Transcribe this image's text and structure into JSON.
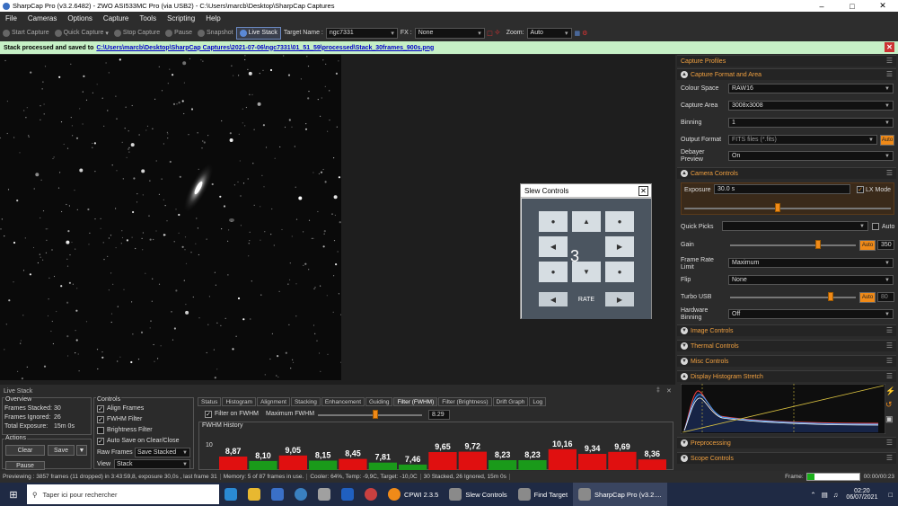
{
  "window": {
    "title": "SharpCap Pro (v3.2.6482) - ZWO ASI533MC Pro (via USB2) - C:\\Users\\marcb\\Desktop\\SharpCap Captures"
  },
  "menu": [
    "File",
    "Cameras",
    "Options",
    "Capture",
    "Tools",
    "Scripting",
    "Help"
  ],
  "toolbar": {
    "start_capture": "Start Capture",
    "quick_capture": "Quick Capture",
    "stop_capture": "Stop Capture",
    "pause": "Pause",
    "snapshot": "Snapshot",
    "live_stack": "Live Stack",
    "target_label": "Target Name :",
    "target_value": "ngc7331",
    "fx_label": "FX :",
    "fx_value": "None",
    "zoom_label": "Zoom:",
    "zoom_value": "Auto"
  },
  "notification": {
    "prefix": "Stack processed and saved to",
    "path": "C:\\Users\\marcb\\Desktop\\SharpCap Captures\\2021-07-06\\ngc7331\\01_51_59\\processed\\Stack_30frames_900s.png"
  },
  "right_panel": {
    "sections": {
      "capture_profiles": "Capture Profiles",
      "capture_format": "Capture Format and Area",
      "camera_controls": "Camera Controls",
      "image_controls": "Image Controls",
      "thermal_controls": "Thermal Controls",
      "misc_controls": "Misc Controls",
      "histogram": "Display Histogram Stretch",
      "preprocessing": "Preprocessing",
      "scope_controls": "Scope Controls"
    },
    "colour_space": {
      "label": "Colour Space",
      "value": "RAW16"
    },
    "capture_area": {
      "label": "Capture Area",
      "value": "3008x3008"
    },
    "binning": {
      "label": "Binning",
      "value": "1"
    },
    "output_format": {
      "label": "Output Format",
      "value": "FITS files (*.fits)",
      "auto": "Auto"
    },
    "debayer": {
      "label": "Debayer Preview",
      "value": "On"
    },
    "exposure": {
      "label": "Exposure",
      "value": "30.0 s",
      "lx_mode": "LX Mode",
      "level": 0.45
    },
    "quick_picks": {
      "label": "Quick Picks",
      "auto": "Auto"
    },
    "gain": {
      "label": "Gain",
      "auto": "Auto",
      "value": "350",
      "level": 0.7
    },
    "frame_rate": {
      "label": "Frame Rate Limit",
      "value": "Maximum"
    },
    "flip": {
      "label": "Flip",
      "value": "None"
    },
    "turbo_usb": {
      "label": "Turbo USB",
      "auto": "Auto",
      "value": "80",
      "level": 0.8
    },
    "hardware_binning": {
      "label": "Hardware Binning",
      "value": "Off"
    }
  },
  "slew": {
    "title": "Slew Controls",
    "rate_number": "3",
    "rate_label": "RATE"
  },
  "live_stack": {
    "title": "Live Stack",
    "overview_title": "Overview",
    "frames_stacked_label": "Frames Stacked:",
    "frames_stacked": "30",
    "frames_ignored_label": "Frames Ignored:",
    "frames_ignored": "26",
    "total_exposure_label": "Total Exposure:",
    "total_exposure": "15m 0s",
    "actions_title": "Actions",
    "clear": "Clear",
    "save": "Save",
    "pause": "Pause",
    "controls_title": "Controls",
    "align_frames": "Align Frames",
    "fwhm_filter": "FWHM Filter",
    "brightness_filter": "Brightness Filter",
    "auto_save": "Auto Save on Clear/Close",
    "raw_frames_label": "Raw Frames",
    "raw_frames_value": "Save Stacked",
    "view_label": "View",
    "view_value": "Stack",
    "tabs": [
      "Status",
      "Histogram",
      "Alignment",
      "Stacking",
      "Enhancement",
      "Guiding",
      "Filter (FWHM)",
      "Filter (Brightness)",
      "Drift Graph",
      "Log"
    ],
    "filter_on_fwhm": "Filter on FWHM",
    "max_fwhm_label": "Maximum FWHM",
    "max_fwhm_value": "8.29",
    "max_fwhm_level": 0.55,
    "fwhm_history_title": "FWHM History",
    "y_axis_label": "10"
  },
  "chart_data": {
    "type": "bar",
    "title": "FWHM History",
    "values": [
      8.87,
      8.1,
      9.05,
      8.15,
      8.45,
      7.81,
      7.46,
      9.65,
      9.72,
      8.23,
      8.23,
      10.16,
      9.34,
      9.69,
      8.36
    ],
    "labels": [
      "8,87",
      "8,10",
      "9,05",
      "8,15",
      "8,45",
      "7,81",
      "7,46",
      "9,65",
      "9,72",
      "8,23",
      "8,23",
      "10,16",
      "9,34",
      "9,69",
      "8,36"
    ],
    "threshold": 8.29,
    "colors": {
      "above": "#e01010",
      "below": "#1a9a1a"
    }
  },
  "statusbar": {
    "previewing": "Previewing : 3857 frames (11 dropped) in 3:43:59,8, exposure 30,0s , last frame 31",
    "memory": "Memory: 5 of 87 frames in use.",
    "cooler": "Cooler: 64%, Temp: -9,9C, Target: -10,0C",
    "stacked": "30 Stacked, 26 Ignored, 15m 0s",
    "frame_label": "Frame:",
    "frame_time": "00:00/00:23",
    "frame_progress": 0.15
  },
  "taskbar": {
    "search_placeholder": "Taper ici pour rechercher",
    "apps": [
      "CPWI 2.3.5",
      "Slew Controls",
      "Find Target",
      "SharpCap Pro (v3.2...."
    ],
    "time": "02:20",
    "date": "06/07/2021"
  },
  "colors": {
    "accent": "#f08a18",
    "notification_bg": "#c6f0c6",
    "taskbar": "#1f2a44"
  }
}
